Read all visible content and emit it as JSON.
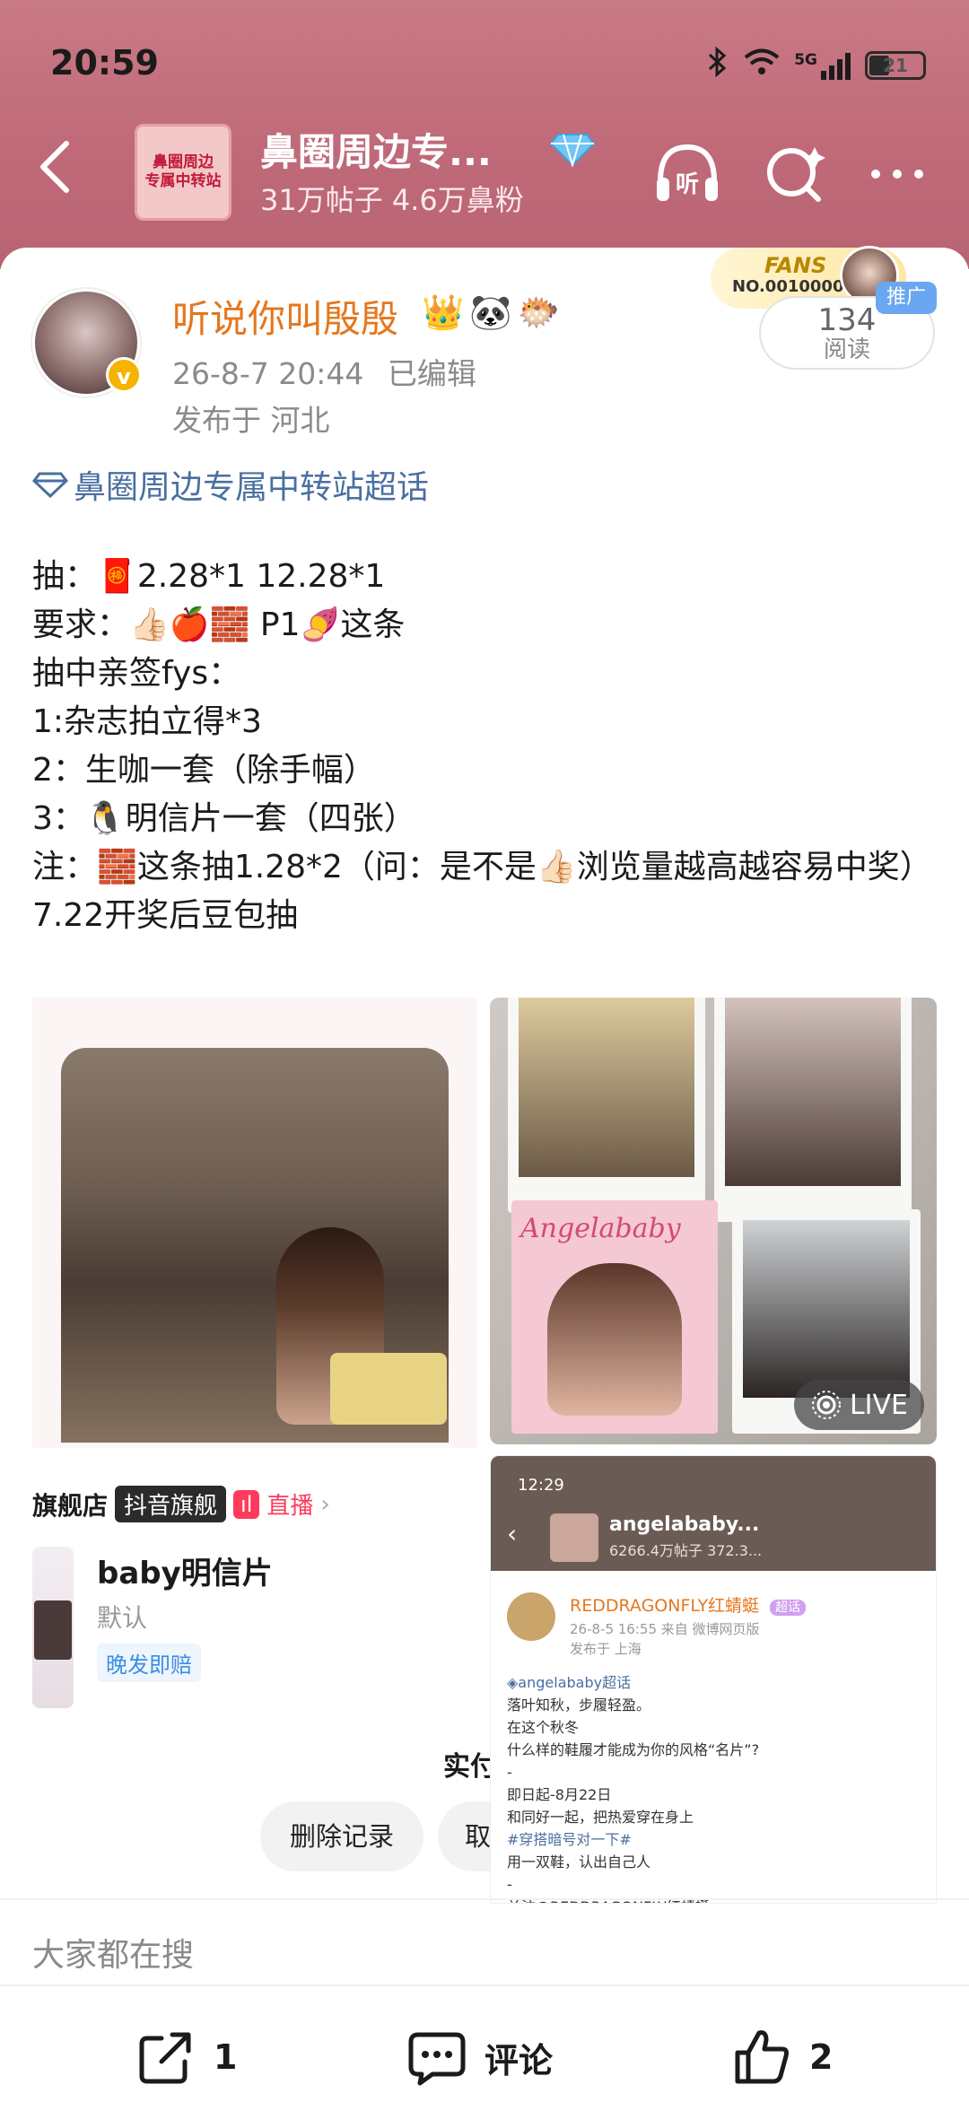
{
  "status_bar": {
    "time": "20:59",
    "network": "5G",
    "battery": "21"
  },
  "header": {
    "topic_thumb_lines": [
      "鼻圈周边",
      "专属中转站"
    ],
    "title": "鼻圈周边专...",
    "subtitle": "31万帖子 4.6万鼻粉",
    "accent_color": "#c06a79",
    "icons": [
      "back-icon",
      "diamond-icon",
      "listen-icon",
      "search-icon",
      "more-icon"
    ]
  },
  "post": {
    "username": "听说你叫殷殷",
    "username_emoji": [
      "👑",
      "🐼",
      "🐡"
    ],
    "time": "26-8-7 20:44",
    "edited": "已编辑",
    "location": "发布于 河北",
    "fans_card": {
      "label": "FANS",
      "number": "NO.0010000"
    },
    "promo_tag": "推广",
    "read_count": "134",
    "read_label": "阅读",
    "topic_link": "鼻圈周边专属中转站超话",
    "body_lines": [
      "抽：🧧2.28*1 12.28*1",
      "要求：👍🏻🍎🧱 P1🍠这条",
      "抽中亲签fys：",
      "1:杂志拍立得*3",
      "2：生咖一套（除手幅）",
      "3：🐧明信片一套（四张）",
      "注：🧱这条抽1.28*2（问：是不是👍🏻浏览量越高越容易中奖）",
      "7.22开奖后豆包抽"
    ]
  },
  "images": {
    "live_badge": "LIVE",
    "shop": {
      "label": "旗舰店",
      "badge1": "抖音旗舰",
      "badge2": "直播",
      "product_name": "baby明信片",
      "variant": "默认",
      "shipping": "晚发即赔",
      "partial_text": "实付",
      "delete_button": "删除记录",
      "partial_button": "取"
    },
    "magazine_title": "Angelababy",
    "screenshot": {
      "time": "12:29",
      "title": "angelababy...",
      "sub": "6266.4万帖子 372.3...",
      "user": "REDDRAGONFLY红蜻蜓",
      "topic_tag": "超话",
      "meta1": "26-8-5 16:55  来自 微博网页版",
      "meta2": "发布于 上海",
      "lines": [
        "◈angelababy超话",
        "落叶知秋，步履轻盈。",
        "在这个秋冬",
        "什么样的鞋履才能成为你的风格“名片”?",
        "-",
        "即日起-8月22日",
        "和同好一起，把热爱穿在身上",
        "#穿搭暗号对一下#",
        "用一双鞋，认出自己人",
        "-",
        "关注@REDDRAGONFLY红蜻蜓"
      ]
    }
  },
  "search": {
    "hint": "大家都在搜"
  },
  "bottom_bar": {
    "share_count": "1",
    "comment_label": "评论",
    "like_count": "2"
  }
}
